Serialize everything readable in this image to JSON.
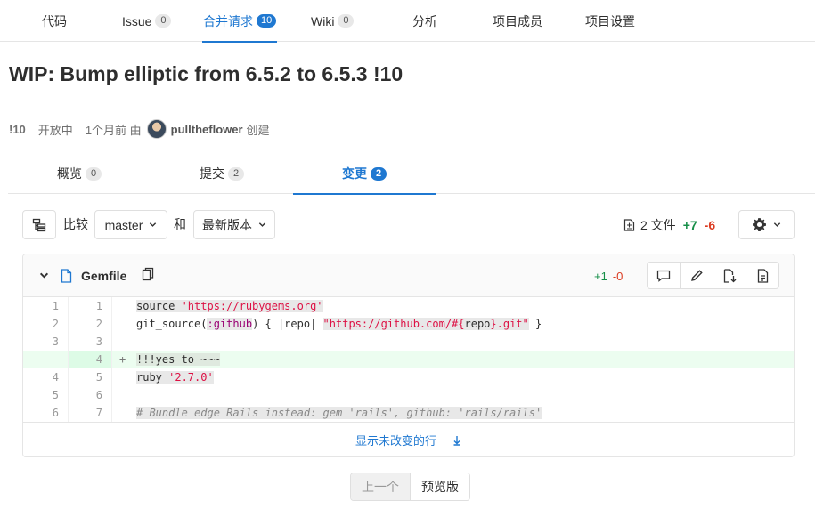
{
  "top_nav": {
    "tabs": [
      {
        "label": "代码",
        "count": null
      },
      {
        "label": "Issue",
        "count": "0"
      },
      {
        "label": "合并请求",
        "count": "10",
        "active": true
      },
      {
        "label": "Wiki",
        "count": "0"
      },
      {
        "label": "分析",
        "count": null
      },
      {
        "label": "项目成员",
        "count": null
      },
      {
        "label": "项目设置",
        "count": null
      }
    ]
  },
  "mr": {
    "title": "WIP: Bump elliptic from 6.5.2 to 6.5.3 !10",
    "iid": "!10",
    "state": "开放中",
    "time": "1个月前 由",
    "author": "pulltheflower",
    "action": "创建"
  },
  "mr_tabs": [
    {
      "label": "概览",
      "count": "0"
    },
    {
      "label": "提交",
      "count": "2"
    },
    {
      "label": "变更",
      "count": "2",
      "active": true
    }
  ],
  "toolbar": {
    "compare_label": "比较",
    "source_branch": "master",
    "and_label": "和",
    "target_version": "最新版本",
    "files_count": "2 文件",
    "additions": "+7",
    "deletions": "-6"
  },
  "file": {
    "name": "Gemfile",
    "additions": "+1",
    "deletions": "-0",
    "expand_label": "显示未改变的行"
  },
  "diff_lines": [
    {
      "old": "1",
      "new": "1",
      "type": "context"
    },
    {
      "old": "2",
      "new": "2",
      "type": "context"
    },
    {
      "old": "3",
      "new": "3",
      "type": "context"
    },
    {
      "old": "",
      "new": "4",
      "type": "added",
      "marker": "+"
    },
    {
      "old": "4",
      "new": "5",
      "type": "context"
    },
    {
      "old": "5",
      "new": "6",
      "type": "context"
    },
    {
      "old": "6",
      "new": "7",
      "type": "context"
    }
  ],
  "code": {
    "l1_a": "source ",
    "l1_b": "'https://rubygems.org'",
    "l2_a": "git_source(",
    "l2_b": ":github",
    "l2_c": ") { |repo| ",
    "l2_d": "\"https://github.com/#{",
    "l2_e": "repo",
    "l2_f": "}.git\"",
    "l2_g": " }",
    "l4": "!!!yes to ~~~",
    "l5_a": "ruby ",
    "l5_b": "'2.7.0'",
    "l7_a": "# Bundle edge Rails instead: gem ",
    "l7_b": "'rails'",
    "l7_c": ", github: ",
    "l7_d": "'rails/rails'"
  },
  "pager": {
    "prev": "上一个",
    "next": "预览版"
  },
  "colors": {
    "accent": "#1f78d1",
    "add": "#168f48",
    "del": "#db3b21"
  }
}
